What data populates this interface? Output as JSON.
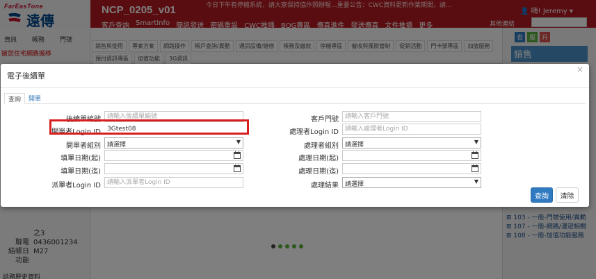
{
  "header": {
    "logo_en": "FarEasTone",
    "logo_cn": "遠傳",
    "app_title": "NCP_0205_v01",
    "marquee": "今日下午有停機系統，請大家保持協作照辦喔...重要公告：CWC資料更新作業期間，請...",
    "user_label": "嗨! Jeremy",
    "other_links_label": "其他連結",
    "menu": [
      "客戶查詢",
      "SmartInfo",
      "簡訊發送",
      "密碼重設",
      "CWC推播",
      "BOG專區",
      "傳真進件",
      "發送傳真",
      "文件推播",
      "更多"
    ]
  },
  "left_panel": {
    "tabs": [
      "資訊",
      "帳務",
      "門號"
    ],
    "warning": "搶您住宅網路搬移",
    "info_rows": [
      {
        "key": "",
        "value": "之3"
      },
      {
        "key": "聯電",
        "value": "0436001234"
      },
      {
        "key": "結帳日",
        "value": "M27"
      },
      {
        "key": "功能",
        "value": ""
      }
    ],
    "bottom_label": "話務歷史資料"
  },
  "func_bar": {
    "row1": [
      "銷售與使用",
      "專案方案",
      "網路操作",
      "帳戶查詢/異動",
      "通訊設備/維修",
      "帳務及繳款",
      "停機專區",
      "催收與風險管制",
      "促銷活動",
      "門卡號專區",
      "加值服務"
    ],
    "row2": [
      "預付資訊專區",
      "加值功能",
      "3G資訊"
    ]
  },
  "right_panel": {
    "buttons": [
      "查",
      "服",
      "升"
    ],
    "title": "銷售",
    "tree": [
      "103 - 一般-門號使用/異動",
      "107 - 一般-網路/漫遊相關",
      "108 - 一般-加值功能服務"
    ]
  },
  "modal": {
    "title": "電子後續單",
    "close": "×",
    "tabs": [
      {
        "label": "查詢"
      },
      {
        "label": "開單"
      }
    ],
    "left_fields": {
      "followup_no": {
        "label": "後續單編號",
        "placeholder": "請輸入後續單編號",
        "value": ""
      },
      "opener_login": {
        "label": "開單者Login ID",
        "value": "3Gtest08"
      },
      "opener_group": {
        "label": "開單者組別",
        "selected": "請選擇"
      },
      "fill_date_from": {
        "label": "填單日期(起)"
      },
      "fill_date_to": {
        "label": "填單日期(迄)"
      },
      "dispatcher_login": {
        "label": "派單者Login ID",
        "placeholder": "請輸入派單者Login ID"
      }
    },
    "right_fields": {
      "customer_no": {
        "label": "客戶門號",
        "placeholder": "請輸入客戶門號"
      },
      "handler_login": {
        "label": "處理者Login ID",
        "placeholder": "請輸入處理者Login ID"
      },
      "handler_group": {
        "label": "處理者組別",
        "selected": "請選擇"
      },
      "handle_date_from": {
        "label": "處理日期(起)"
      },
      "handle_date_to": {
        "label": "處理日期(迄)"
      },
      "handle_result": {
        "label": "處理結果",
        "selected": "請選擇"
      }
    },
    "buttons": {
      "query": "查詢",
      "clear": "清除"
    }
  },
  "colors": {
    "brand_red": "#b51a20",
    "primary_blue": "#2f7ac1",
    "highlight_red": "#d81d1d"
  }
}
